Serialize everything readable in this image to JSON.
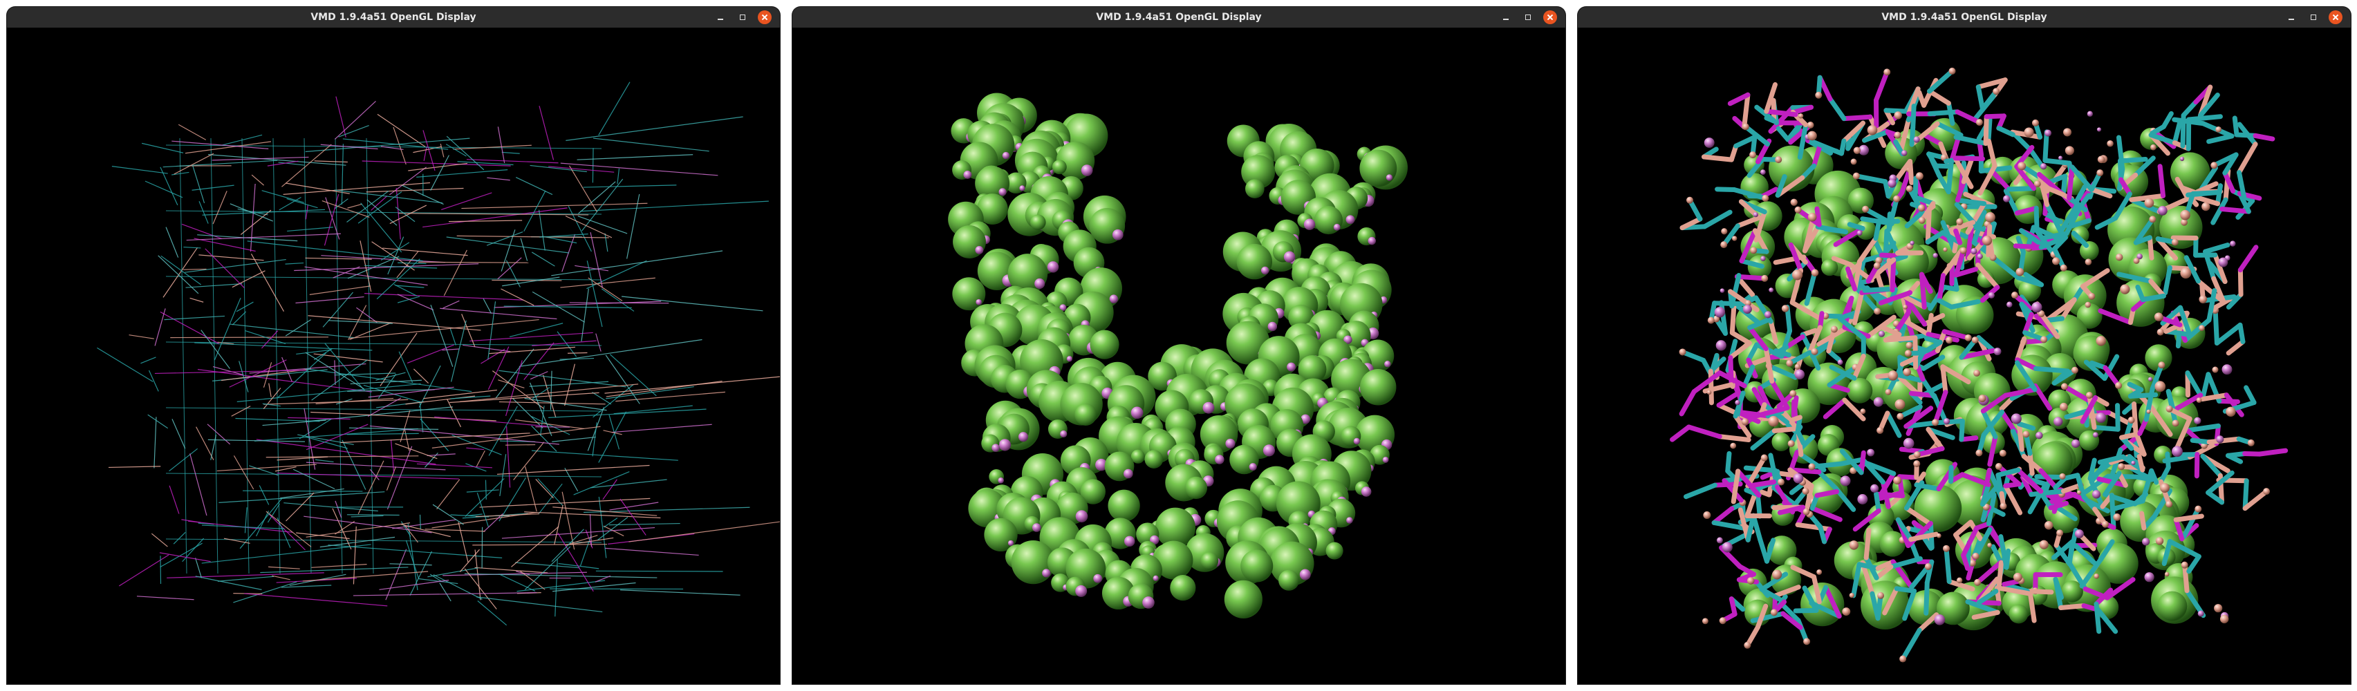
{
  "windows": [
    {
      "title": "VMD 1.9.4a51 OpenGL Display",
      "representation": "lines"
    },
    {
      "title": "VMD 1.9.4a51 OpenGL Display",
      "representation": "vdw"
    },
    {
      "title": "VMD 1.9.4a51 OpenGL Display",
      "representation": "licorice-vdw"
    }
  ],
  "colors": {
    "titlebar": "#2c2c2c",
    "viewport": "#000000",
    "close": "#e95420",
    "atom_green": "#6bbf4a",
    "atom_pink": "#d080d0",
    "atom_cyan": "#2aa6a8",
    "atom_tan": "#e0a090",
    "atom_magenta": "#c020c0"
  },
  "icons": [
    "minimize-icon",
    "maximize-icon",
    "close-icon"
  ]
}
